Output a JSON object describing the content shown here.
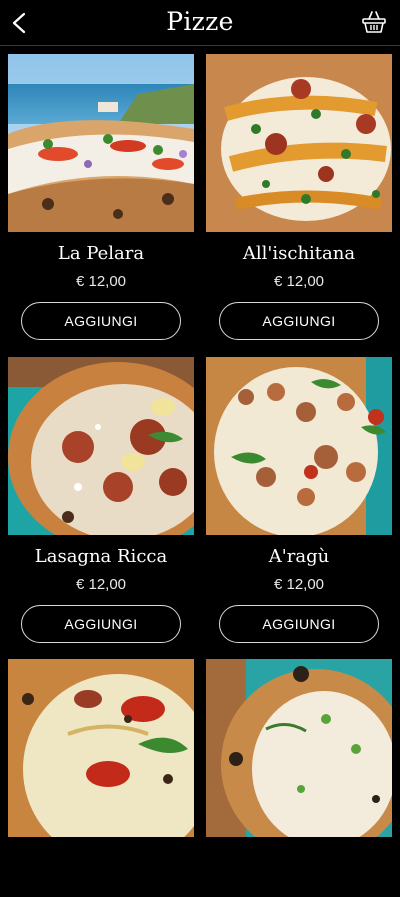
{
  "header": {
    "title": "Pizze",
    "back_icon": "chevron-left-icon",
    "cart_icon": "basket-icon"
  },
  "products": [
    {
      "name": "La Pelara",
      "price": "€ 12,00",
      "button": "AGGIUNGI"
    },
    {
      "name": "All'ischitana",
      "price": "€ 12,00",
      "button": "AGGIUNGI"
    },
    {
      "name": "Lasagna Ricca",
      "price": "€ 12,00",
      "button": "AGGIUNGI"
    },
    {
      "name": "A'ragù",
      "price": "€ 12,00",
      "button": "AGGIUNGI"
    },
    {
      "name": "",
      "price": "",
      "button": ""
    },
    {
      "name": "",
      "price": "",
      "button": ""
    }
  ]
}
